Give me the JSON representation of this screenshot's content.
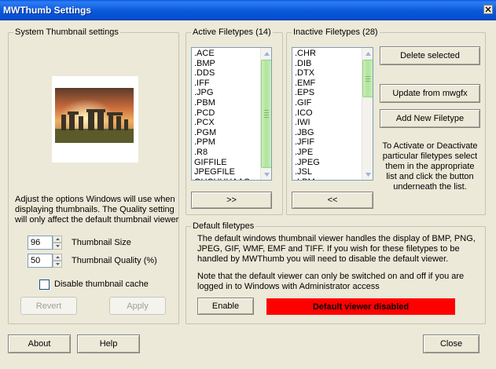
{
  "window": {
    "title": "MWThumb Settings"
  },
  "system_group": {
    "title": "System Thumbnail settings",
    "description": "Adjust the options Windows will use when displaying thumbnails. The Quality setting will only affect the default thumbnail viewer",
    "size_value": "96",
    "size_label": "Thumbnail Size",
    "quality_value": "50",
    "quality_label": "Thumbnail Quality (%)",
    "disable_cache_label": "Disable thumbnail cache",
    "revert_label": "Revert",
    "apply_label": "Apply"
  },
  "active_group": {
    "title": "Active Filetypes (14)",
    "items": [
      ".ACE",
      ".BMP",
      ".DDS",
      ".IFF",
      ".JPG",
      ".PBM",
      ".PCD",
      ".PCX",
      ".PGM",
      ".PPM",
      ".R8",
      "GIFFILE",
      "JPEGFILE",
      "OUCHHHAAC"
    ],
    "move_button": ">>"
  },
  "inactive_group": {
    "title": "Inactive Filetypes (28)",
    "items": [
      ".CHR",
      ".DIB",
      ".DTX",
      ".EMF",
      ".EPS",
      ".GIF",
      ".ICO",
      ".IWI",
      ".JBG",
      ".JFIF",
      ".JPE",
      ".JPEG",
      ".JSL",
      ".LBM"
    ],
    "move_button": "<<"
  },
  "actions": {
    "delete_label": "Delete selected",
    "update_label": "Update from mwgfx",
    "add_label": "Add New Filetype",
    "help_text": "To Activate or Deactivate particular filetypes select them in the appropriate list  and click the button underneath the list."
  },
  "default_group": {
    "title": "Default filetypes",
    "description": "The default windows thumbnail viewer handles the display of BMP, PNG, JPEG, GIF, WMF, EMF and TIFF.  If you wish for these filetypes to be handled by MWThumb you will need to disable the default viewer.",
    "note": "Note that the default viewer can only be switched on and off if you are logged in to Windows with Administrator access",
    "enable_label": "Enable",
    "status": "Default viewer disabled",
    "status_color": "#ff0000"
  },
  "footer": {
    "about_label": "About",
    "help_label": "Help",
    "close_label": "Close"
  }
}
